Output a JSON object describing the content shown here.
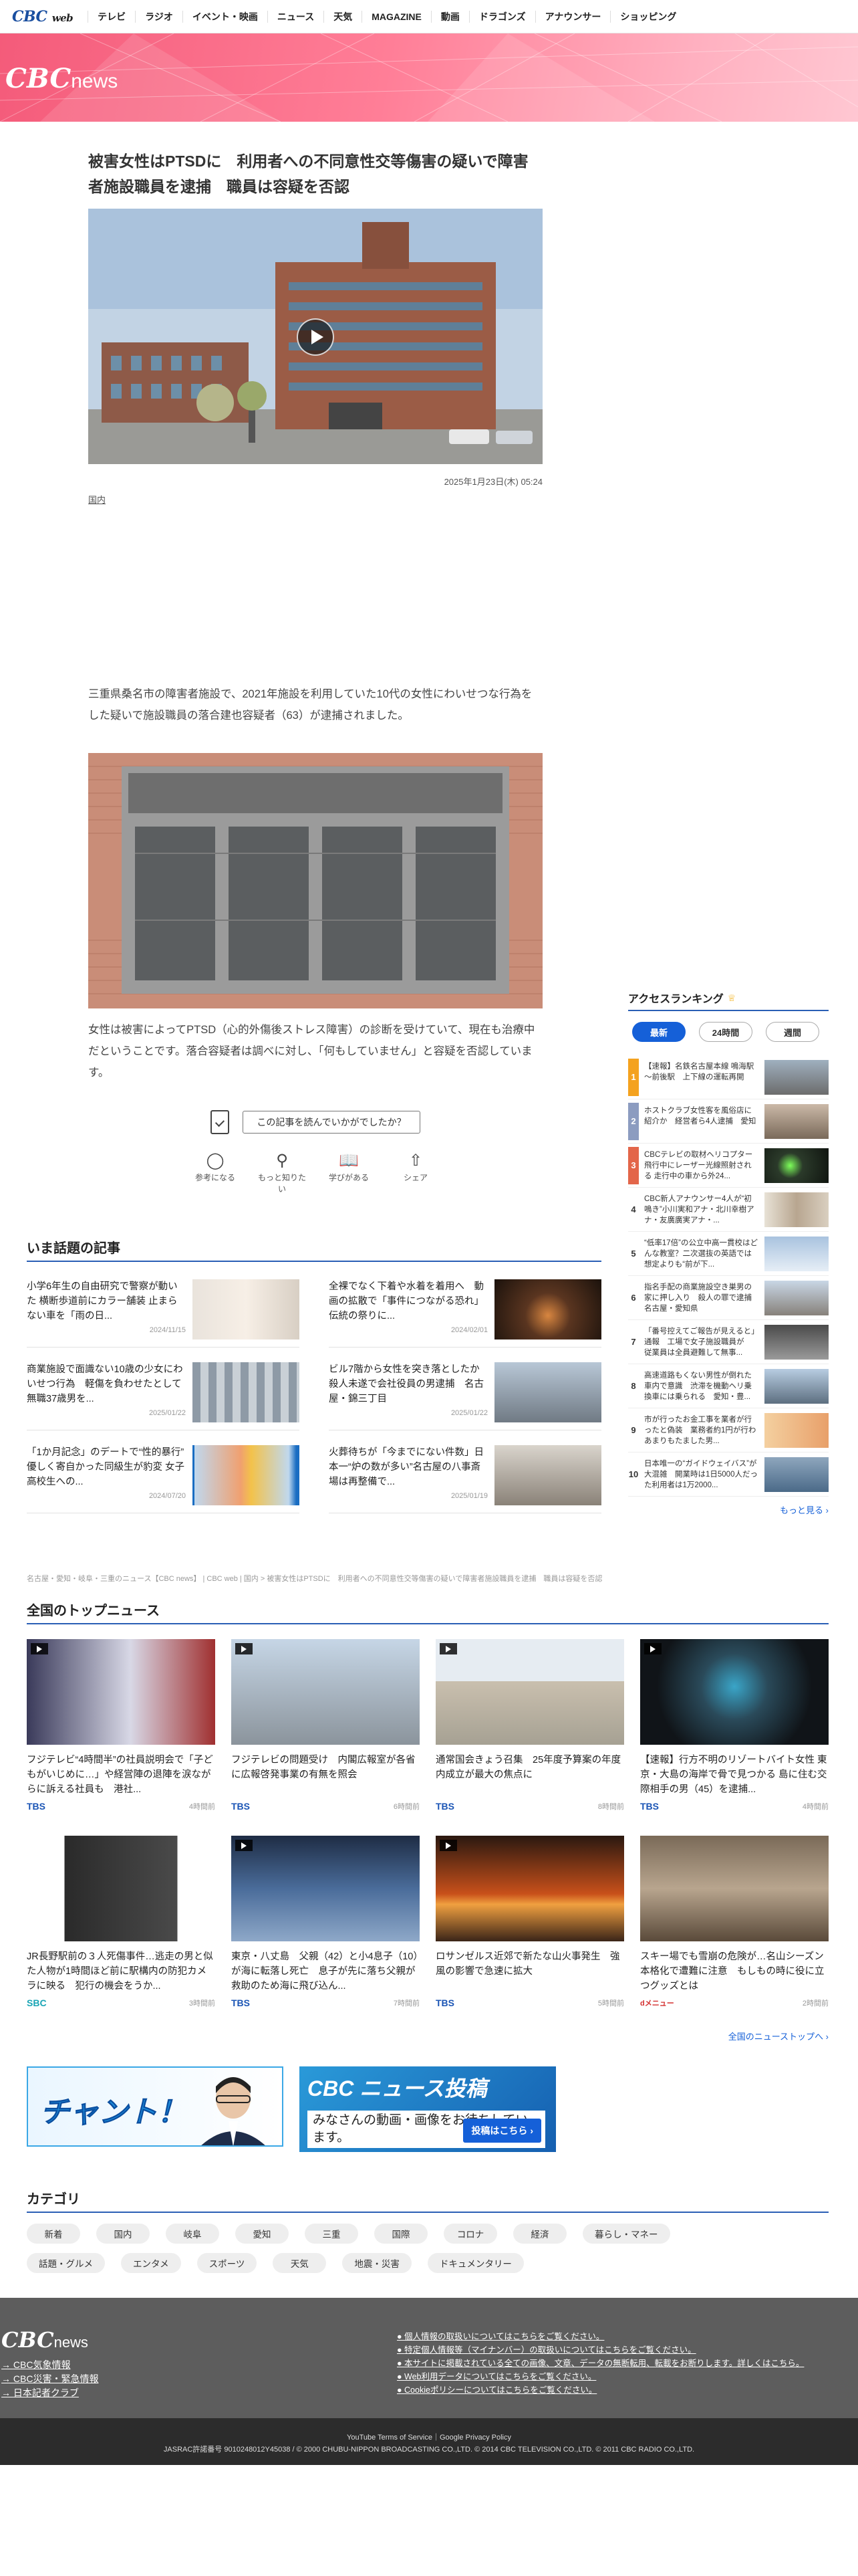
{
  "topnav": {
    "logo": "CBC",
    "logo_sub": "web",
    "items": [
      "テレビ",
      "ラジオ",
      "イベント・映画",
      "ニュース",
      "天気",
      "MAGAZINE",
      "動画",
      "ドラゴンズ",
      "アナウンサー",
      "ショッピング"
    ]
  },
  "hero": {
    "brand": "CBC",
    "brand_sub": "news"
  },
  "article": {
    "title": "被害女性はPTSDに　利用者への不同意性交等傷害の疑いで障害者施設職員を逮捕　職員は容疑を否認",
    "datetime": "2025年1月23日(木) 05:24",
    "genre": "国内",
    "paragraph1": "三重県桑名市の障害者施設で、2021年施設を利用していた10代の女性にわいせつな行為をした疑いで施設職員の落合建也容疑者（63）が逮捕されました。",
    "paragraph2": "女性は被害によってPTSD（心的外傷後ストレス障害）の診断を受けていて、現在も治療中だということです。落合容疑者は調べに対し、「何もしていません」と容疑を否認しています。",
    "feedback_question": "この記事を読んでいかがでしたか？",
    "feedback_buttons": [
      "参考になる",
      "もっと知りたい",
      "学びがある",
      "シェア"
    ]
  },
  "ranking": {
    "title": "アクセスランキング",
    "tabs": [
      "最新",
      "24時間",
      "週間"
    ],
    "items": [
      {
        "rank": "1",
        "text": "【速報】名鉄名古屋本線 鳴海駅～前後駅　上下線の運転再開"
      },
      {
        "rank": "2",
        "text": "ホストクラブ女性客を風俗店に紹介か　経営者ら4人逮捕　愛知"
      },
      {
        "rank": "3",
        "text": "CBCテレビの取材ヘリコプター飛行中にレーザー光線照射される 走行中の車から外24..."
      },
      {
        "rank": "4",
        "text": "CBC新人アナウンサー4人が“初鳴き”小川実和アナ・北川幸樹アナ・友廣廣実アナ・..."
      },
      {
        "rank": "5",
        "text": "“低率17倍”の公立中高一貫校はどんな教室？二次選抜の英語では想定よりも“前が下..."
      },
      {
        "rank": "6",
        "text": "指名手配の商業施設空き巣男の家に押し入り　殺人の罪で逮捕 名古屋・愛知県"
      },
      {
        "rank": "7",
        "text": "「番号控えてご報告が見えると」通報　工場で女子施設職員が　従業員は全員避難して無事..."
      },
      {
        "rank": "8",
        "text": "高速道路もくない男性が倒れた車内で意識　渋滞を機動ヘリ乗換車には乗られる　愛知・豊..."
      },
      {
        "rank": "9",
        "text": "市が行ったお金工事を業者が行ったと偽装　業務者約1円が行わあまりもたました男..."
      },
      {
        "rank": "10",
        "text": "日本唯一の“ガイドウェイバス”が大混雑　開業時は1日5000人だった利用者は1万2000..."
      }
    ],
    "more": "もっと見る"
  },
  "trending": {
    "title": "いま話題の記事",
    "items": [
      {
        "text": "小学6年生の自由研究で警察が動いた 横断歩道前にカラー舗装 止まらない車を「雨の日...",
        "date": "2024/11/15"
      },
      {
        "text": "全裸でなく下着や水着を着用へ　動画の拡散で「事件につながる恐れ」 伝統の祭りに...",
        "date": "2024/02/01"
      },
      {
        "text": "商業施設で面識ない10歳の少女にわいせつ行為　軽傷を負わせたとして無職37歳男を...",
        "date": "2025/01/22"
      },
      {
        "text": "ビル7階から女性を突き落としたか　殺人未遂で会社役員の男逮捕　名古屋・錦三丁目",
        "date": "2025/01/22"
      },
      {
        "text": "「1か月記念」のデートで“性的暴行” 優しく寄自かった同級生が豹変 女子高校生への...",
        "date": "2024/07/20"
      },
      {
        "text": "火葬待ちが「今までにない件数」日本一“炉の数が多い”名古屋の八事斎場は再整備で...",
        "date": "2025/01/19"
      }
    ]
  },
  "breadcrumb": "名古屋・愛知・岐阜・三重のニュース【CBC news】 | CBC web | 国内 > 被害女性はPTSDに　利用者への不同意性交等傷害の疑いで障害者施設職員を逮捕　職員は容疑を否認",
  "topnews": {
    "title": "全国のトップニュース",
    "items": [
      {
        "text": "フジテレビ“4時間半”の社員説明会で「子どもがいじめに…」や経営陣の退陣を涙ながらに訴える社員も　港社...",
        "source": "TBS",
        "time": "4時間前"
      },
      {
        "text": "フジテレビの問題受け　内閣広報室が各省に広報啓発事業の有無を照会",
        "source": "TBS",
        "time": "6時間前"
      },
      {
        "text": "通常国会きょう召集　25年度予算案の年度内成立が最大の焦点に",
        "source": "TBS",
        "time": "8時間前"
      },
      {
        "text": "【速報】行方不明のリゾートバイト女性 東京・大島の海岸で骨で見つかる 島に住む交際相手の男（45）を逮捕...",
        "source": "TBS",
        "time": "4時間前"
      },
      {
        "text": "JR長野駅前の３人死傷事件…逃走の男と似た人物が1時間ほど前に駅構内の防犯カメラに映る　犯行の機会をうか...",
        "source": "SBC",
        "time": "3時間前"
      },
      {
        "text": "東京・八丈島　父親（42）と小4息子（10）が海に転落し死亡　息子が先に落ち父親が救助のため海に飛び込ん...",
        "source": "TBS",
        "time": "7時間前"
      },
      {
        "text": "ロサンゼルス近郊で新たな山火事発生　強風の影響で急速に拡大",
        "source": "TBS",
        "time": "5時間前"
      },
      {
        "text": "スキー場でも雪崩の危険が…名山シーズン本格化で遭難に注意　もしもの時に役に立つグッズとは",
        "source": "dメニュー",
        "time": "2時間前"
      }
    ],
    "all_link": "全国のニューストップへ"
  },
  "banners": {
    "chant": "チャント！",
    "post_title": "CBC ニュース投稿",
    "post_sub": "みなさんの動画・画像をお待ちしています。",
    "post_btn": "投稿はこちら"
  },
  "category": {
    "title": "カテゴリ",
    "items": [
      "新着",
      "国内",
      "岐阜",
      "愛知",
      "三重",
      "国際",
      "コロナ",
      "経済",
      "暮らし・マネー",
      "話題・グルメ",
      "エンタメ",
      "スポーツ",
      "天気",
      "地震・災害",
      "ドキュメンタリー"
    ]
  },
  "footer": {
    "logo": "CBC",
    "logo_sub": "news",
    "links": [
      "CBC気象情報",
      "CBC災害・緊急情報",
      "日本記者クラブ"
    ],
    "policies": [
      "個人情報の取扱いについてはこちらをご覧ください。",
      "特定個人情報等（マイナンバー）の取扱いについてはこちらをご覧ください。",
      "本サイトに掲載されている全ての画像、文章、データの無断転用、転載をお断りします。詳しくはこちら。",
      "Web利用データについてはこちらをご覧ください。",
      "Cookieポリシーについてはこちらをご覧ください。"
    ],
    "terms": "YouTube Terms of Service｜Google Privacy Policy",
    "copyright": "JASRAC許諾番号 9010248012Y45038 / © 2000 CHUBU-NIPPON BROADCASTING CO.,LTD. © 2014 CBC TELEVISION CO.,LTD. © 2011 CBC RADIO CO.,LTD."
  }
}
